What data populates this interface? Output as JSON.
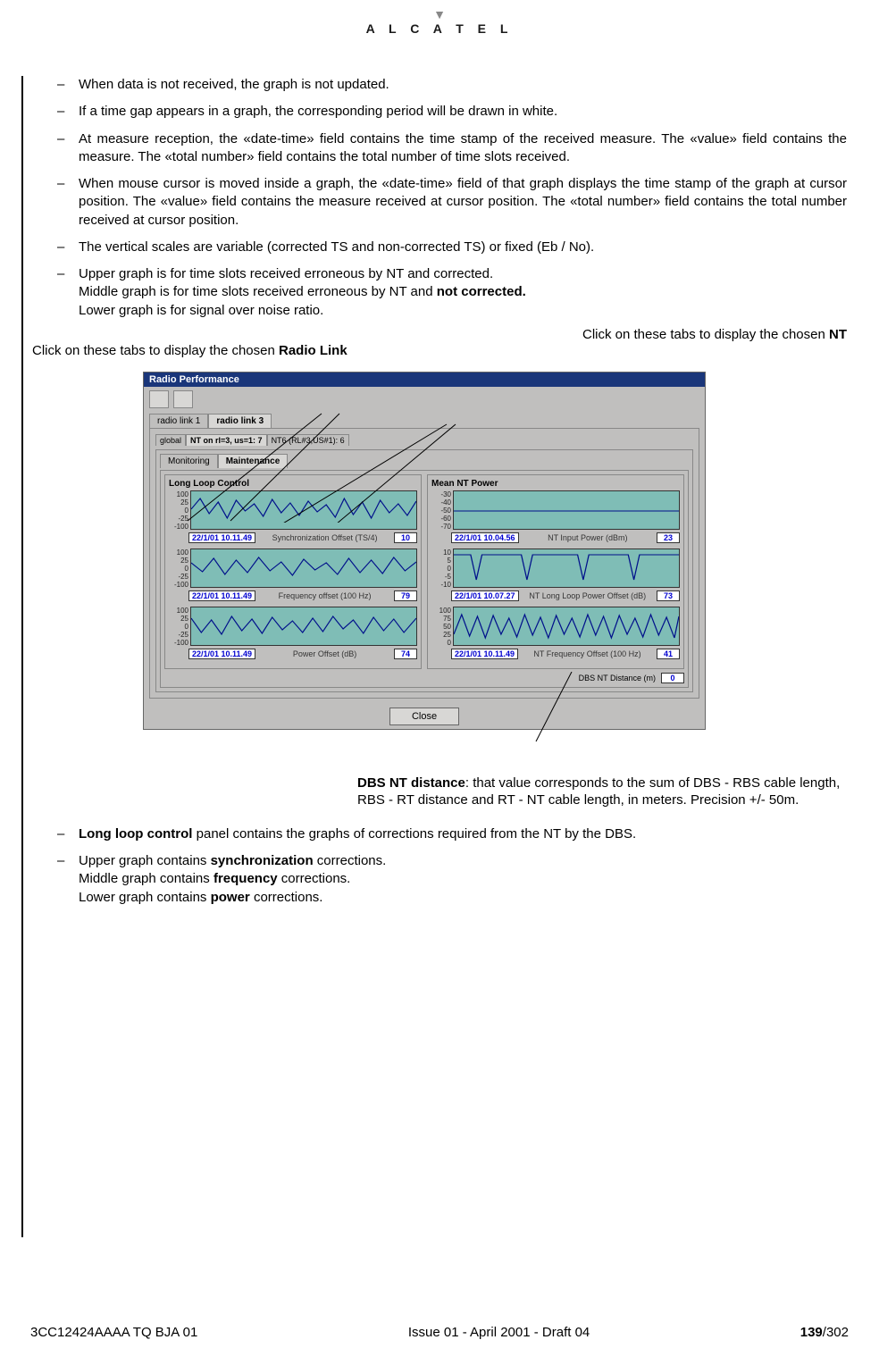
{
  "logo": "A L C A T E L",
  "bullets_top": [
    "When data is not received, the graph is not updated.",
    "If a time gap appears in a graph, the corresponding period will be drawn in white.",
    "At measure reception, the «date-time» field contains the time stamp of the received measure. The «value» field contains the measure. The «total number» field contains the total number of time slots received.",
    "When mouse cursor is moved inside a graph, the «date-time» field of that graph displays the time stamp of the graph at cursor position. The «value» field contains the measure received at cursor position. The «total number» field contains the total number received at cursor position.",
    "The vertical scales are variable (corrected TS and non-corrected TS) or fixed (Eb / No)."
  ],
  "bullet_graphs_line1": "Upper graph is for time slots received erroneous by NT and corrected.",
  "bullet_graphs_line2_pre": "Middle graph is for time slots received erroneous by NT and ",
  "bullet_graphs_line2_bold": "not corrected.",
  "bullet_graphs_line3": "Lower graph is for signal over noise ratio.",
  "callout_left_pre": "Click on these tabs to display the chosen ",
  "callout_left_bold": "Radio Link",
  "callout_right_pre": "Click on these tabs to display the chosen ",
  "callout_right_bold": "NT",
  "window": {
    "title": "Radio Performance",
    "tabs_main": [
      "radio link 1",
      "radio link 3"
    ],
    "tabs_main_active": 1,
    "tabs_sub": [
      "global",
      "NT on rl=3, us=1: 7",
      "NT6 (RL#3,US#1): 6"
    ],
    "tabs_sub_active": 1,
    "tabs_mon": [
      "Monitoring",
      "Maintenance"
    ],
    "tabs_mon_active": 1,
    "left_panel_title": "Long Loop Control",
    "right_panel_title": "Mean NT Power",
    "graphs_left": [
      {
        "yticks": [
          "100",
          "25",
          "0",
          "-25",
          "-100"
        ],
        "date": "22/1/01 10.11.49",
        "label": "Synchronization Offset (TS/4)",
        "value": "10"
      },
      {
        "yticks": [
          "100",
          "25",
          "0",
          "-25",
          "-100"
        ],
        "date": "22/1/01 10.11.49",
        "label": "Frequency offset (100 Hz)",
        "value": "79"
      },
      {
        "yticks": [
          "100",
          "25",
          "0",
          "-25",
          "-100"
        ],
        "date": "22/1/01 10.11.49",
        "label": "Power Offset (dB)",
        "value": "74"
      }
    ],
    "graphs_right": [
      {
        "yticks": [
          "-30",
          "-40",
          "-50",
          "-60",
          "-70"
        ],
        "date": "22/1/01 10.04.56",
        "label": "NT Input Power (dBm)",
        "value": "23"
      },
      {
        "yticks": [
          "10",
          "5",
          "0",
          "-5",
          "-10"
        ],
        "date": "22/1/01 10.07.27",
        "label": "NT Long Loop Power Offset (dB)",
        "value": "73"
      },
      {
        "yticks": [
          "100",
          "75",
          "50",
          "25",
          "0"
        ],
        "date": "22/1/01 10.11.49",
        "label": "NT Frequency Offset (100 Hz)",
        "value": "41"
      }
    ],
    "dbs_label": "DBS NT Distance (m)",
    "dbs_value": "0",
    "close": "Close"
  },
  "callout_dbs_bold": "DBS NT distance",
  "callout_dbs_rest": ": that value corresponds to the sum of DBS - RBS cable length, RBS - RT distance and RT - NT cable length, in meters. Precision +/- 50m.",
  "bullet_llc_bold": "Long loop control",
  "bullet_llc_rest": " panel contains the graphs of corrections required from the NT by the DBS.",
  "bullet_corr_l1_pre": "Upper graph contains ",
  "bullet_corr_l1_bold": "synchronization",
  "bullet_corr_l1_post": " corrections.",
  "bullet_corr_l2_pre": "Middle graph contains ",
  "bullet_corr_l2_bold": "frequency",
  "bullet_corr_l2_post": " corrections.",
  "bullet_corr_l3_pre": "Lower graph contains ",
  "bullet_corr_l3_bold": "power",
  "bullet_corr_l3_post": " corrections.",
  "footer": {
    "left": "3CC12424AAAA TQ BJA 01",
    "center": "Issue 01 - April 2001 - Draft 04",
    "page_bold": "139",
    "page_total": "/302"
  }
}
